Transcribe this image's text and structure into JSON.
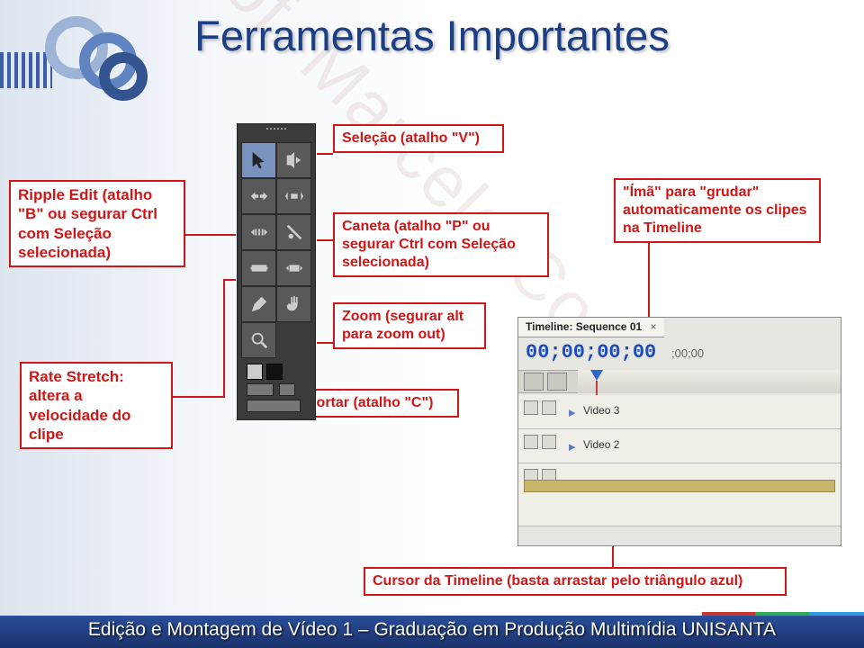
{
  "title": "Ferramentas Importantes",
  "watermark": "Prof. Marcelo Correia",
  "callouts": {
    "selection": "Seleção (atalho \"V\")",
    "ripple": "Ripple Edit (atalho \"B\" ou segurar Ctrl com Seleção selecionada)",
    "pen": "Caneta (atalho \"P\" ou segurar Ctrl com Seleção selecionada)",
    "snap": "\"Ímã\" para \"grudar\" automaticamente os clipes na Timeline",
    "zoom": "Zoom (segurar alt para zoom out)",
    "razor": "Cortar (atalho \"C\")",
    "rate": "Rate Stretch: altera a velocidade do clipe",
    "cursor": "Cursor da Timeline (basta arrastar pelo triângulo azul)"
  },
  "timeline": {
    "tab": "Timeline: Sequence 01",
    "tc": "00;00;00;00",
    "tc_sub": ";00;00",
    "tracks": [
      "Video 3",
      "Video 2"
    ]
  },
  "footer": "Edição e Montagem de Vídeo 1 – Graduação em Produção Multimídia UNISANTA"
}
